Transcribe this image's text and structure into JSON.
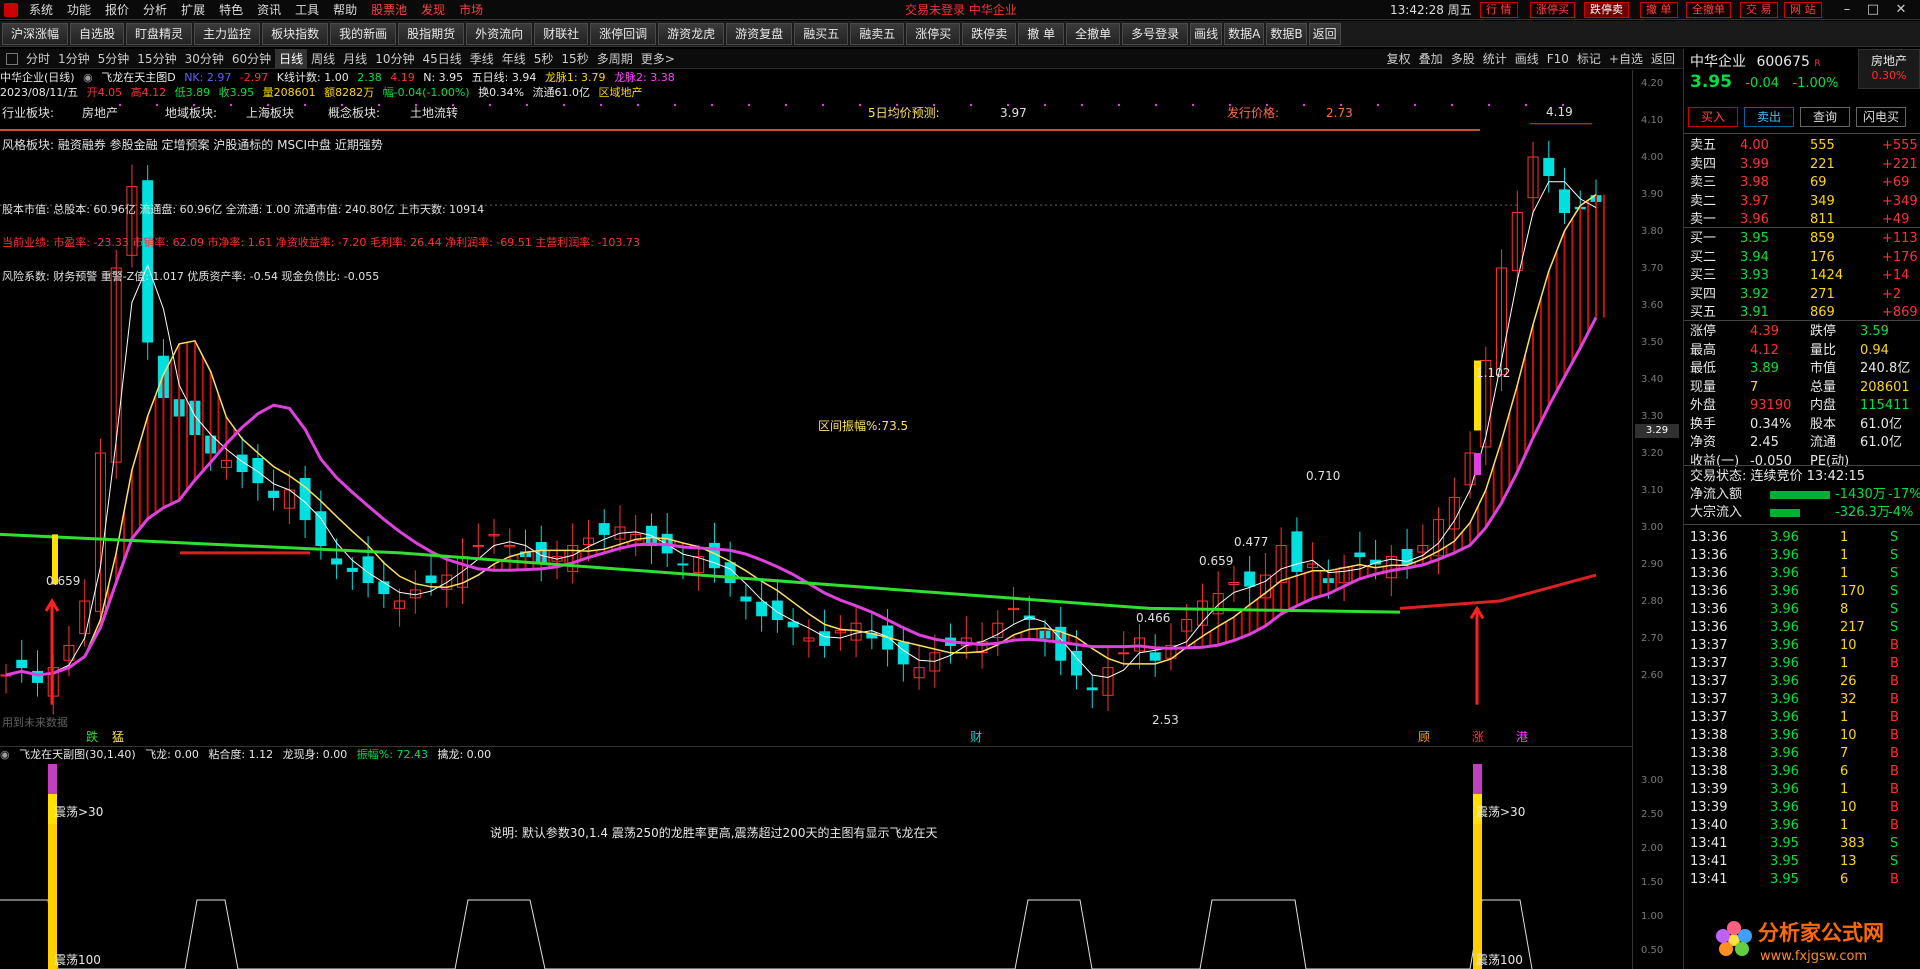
{
  "menu": {
    "items": [
      "系统",
      "功能",
      "报价",
      "分析",
      "扩展",
      "特色",
      "资讯",
      "工具",
      "帮助"
    ],
    "red_items": [
      "股票池",
      "发现",
      "市场"
    ],
    "center_text": "交易未登录  中华企业",
    "clock": "13:42:28 周五",
    "right_buttons": [
      "行 情",
      "涨停买",
      "跌停卖",
      "撤 单",
      "全撤单",
      "交 易",
      "网 站"
    ]
  },
  "toolbar": {
    "buttons": [
      "沪深涨幅",
      "自选股",
      "盯盘精灵",
      "主力监控",
      "板块指数",
      "我的新画",
      "股指期货",
      "外资流向",
      "财联社",
      "涨停回调",
      "游资龙虎",
      "游资复盘",
      "融买五",
      "融卖五",
      "涨停买",
      "跌停卖",
      "撤 单",
      "全撤单",
      "多号登录",
      "画线",
      "数据A",
      "数据B",
      "返回"
    ]
  },
  "periods": [
    "分时",
    "1分钟",
    "5分钟",
    "15分钟",
    "30分钟",
    "60分钟",
    "日线",
    "周线",
    "月线",
    "10分钟",
    "45日线",
    "季线",
    "年线",
    "5秒",
    "15秒",
    "多周期",
    "更多>"
  ],
  "period_active": "日线",
  "period_right": [
    "复权",
    "叠加",
    "多股",
    "统计",
    "画线",
    "F10",
    "标记",
    "+自选",
    "返回"
  ],
  "info1": {
    "name": "中华企业(日线)",
    "indicator": "飞龙在天主图D",
    "nk": "NK: 2.97",
    "v1": "-2.97",
    "kline": "K线计数: 1.00",
    "v2": "2.38",
    "v3": "4.19",
    "n": "N: 3.95",
    "ma5": "五日线: 3.94",
    "long1": "龙脉1: 3.79",
    "long2": "龙脉2: 3.38"
  },
  "info2": {
    "date": "2023/08/11/五",
    "open": "开4.05",
    "high": "高4.12",
    "low": "低3.89",
    "close": "收3.95",
    "vol": "量208601",
    "amt": "额8282万",
    "chg": "幅-0.04(-1.00%)",
    "turn": "换0.34%",
    "flow": "流通61.0亿",
    "sector": "区域地产"
  },
  "overlay": {
    "industry_label": "行业板块:",
    "industry": "房地产",
    "region_label": "地域板块:",
    "region": "上海板块",
    "concept_label": "概念板块:",
    "concept": "土地流转",
    "pred_label": "5日均价预测:",
    "pred": "3.97",
    "issue_label": "发行价格:",
    "issue": "2.73",
    "style": "风格板块:   融资融券 参股金融 定增预案 沪股通标的 MSCI中盘 近期强势",
    "capital": "股本市值: 总股本: 60.96亿 流通盘: 60.96亿 全流通: 1.00 流通市值: 240.80亿 上市天数: 10914",
    "perf": "当前业绩: 市盈率: -23.33 市销率: 62.09 市净率: 1.61 净资收益率: -7.20 毛利率: 26.44 净利润率: -69.51 主营利润率: -103.73",
    "risk": "风险系数: 财务预警 重警-Z值: 1.017 优质资产率: -0.54 现金负债比: -0.055",
    "range": "区间振幅%:73.5",
    "label_0710": "0.710",
    "label_0659a": "0.659",
    "label_0659b": "0.659",
    "label_0477": "0.477",
    "label_0466": "0.466",
    "label_1102": "1.102",
    "label_253": "2.53",
    "label_419": "4.19",
    "nofuture": "用到未来数据",
    "sig1": "跌",
    "sig2": "猛",
    "sig3": "财",
    "sig4": "顾",
    "sig5": "涨",
    "sig6": "港"
  },
  "sub": {
    "title": "飞龙在天副图(30,1.40)",
    "fly": "飞龙: 0.00",
    "fit": "粘合度: 1.12",
    "dragon": "龙现身: 0.00",
    "amp": "振幅%: 72.43",
    "catch": "擒龙: 0.00",
    "note": "说明: 默认参数30,1.4 震荡250的龙胜率更高,震荡超过200天的主图有显示飞龙在天",
    "z30": "震荡>30",
    "z100": "震荡100"
  },
  "axis": {
    "main": [
      "4.20",
      "4.10",
      "4.00",
      "3.90",
      "3.80",
      "3.70",
      "3.60",
      "3.50",
      "3.40",
      "3.30",
      "3.20",
      "3.10",
      "3.00",
      "2.90",
      "2.80",
      "2.70",
      "2.60"
    ],
    "current": "3.29",
    "sub": [
      "3.00",
      "2.50",
      "2.00",
      "1.50",
      "1.00",
      "0.50"
    ]
  },
  "stock": {
    "name": "中华企业",
    "code": "600675",
    "tag": "R",
    "sector": "房地产",
    "price": "3.95",
    "chg": "-0.04",
    "pct": "-1.00%",
    "sector_pct": "0.30%",
    "buttons": [
      "买入",
      "卖出",
      "查询",
      "闪电买"
    ]
  },
  "asks": [
    {
      "label": "卖五",
      "price": "4.00",
      "vol": "555",
      "chg": "+555"
    },
    {
      "label": "卖四",
      "price": "3.99",
      "vol": "221",
      "chg": "+221"
    },
    {
      "label": "卖三",
      "price": "3.98",
      "vol": "69",
      "chg": "+69"
    },
    {
      "label": "卖二",
      "price": "3.97",
      "vol": "349",
      "chg": "+349"
    },
    {
      "label": "卖一",
      "price": "3.96",
      "vol": "811",
      "chg": "+49"
    }
  ],
  "bids": [
    {
      "label": "买一",
      "price": "3.95",
      "vol": "859",
      "chg": "+113"
    },
    {
      "label": "买二",
      "price": "3.94",
      "vol": "176",
      "chg": "+176"
    },
    {
      "label": "买三",
      "price": "3.93",
      "vol": "1424",
      "chg": "+14"
    },
    {
      "label": "买四",
      "price": "3.92",
      "vol": "271",
      "chg": "+2"
    },
    {
      "label": "买五",
      "price": "3.91",
      "vol": "869",
      "chg": "+869"
    }
  ],
  "stats": [
    {
      "l": "涨停",
      "v": "4.39",
      "l2": "跌停",
      "v2": "3.59"
    },
    {
      "l": "最高",
      "v": "4.12",
      "l2": "量比",
      "v2": "0.94"
    },
    {
      "l": "最低",
      "v": "3.89",
      "l2": "市值",
      "v2": "240.8亿"
    },
    {
      "l": "现量",
      "v": "7",
      "l2": "总量",
      "v2": "208601"
    },
    {
      "l": "外盘",
      "v": "93190",
      "l2": "内盘",
      "v2": "115411"
    },
    {
      "l": "换手",
      "v": "0.34%",
      "l2": "股本",
      "v2": "61.0亿"
    },
    {
      "l": "净资",
      "v": "2.45",
      "l2": "流通",
      "v2": "61.0亿"
    },
    {
      "l": "收益(一)",
      "v": "-0.050",
      "l2": "PE(动)",
      "v2": ""
    }
  ],
  "trade_state": "交易状态: 连续竞价 13:42:15",
  "netflow": {
    "label": "净流入额",
    "value": "-1430万",
    "pct": "-17%"
  },
  "bigflow": {
    "label": "大宗流入",
    "value": "-326.3万",
    "pct": "-4%"
  },
  "ticks": [
    {
      "t": "13:36",
      "p": "3.96",
      "v": "1",
      "d": "S"
    },
    {
      "t": "13:36",
      "p": "3.96",
      "v": "1",
      "d": "S"
    },
    {
      "t": "13:36",
      "p": "3.96",
      "v": "1",
      "d": "S"
    },
    {
      "t": "13:36",
      "p": "3.96",
      "v": "170",
      "d": "S"
    },
    {
      "t": "13:36",
      "p": "3.96",
      "v": "8",
      "d": "S"
    },
    {
      "t": "13:36",
      "p": "3.96",
      "v": "217",
      "d": "S"
    },
    {
      "t": "13:37",
      "p": "3.96",
      "v": "10",
      "d": "B"
    },
    {
      "t": "13:37",
      "p": "3.96",
      "v": "1",
      "d": "B"
    },
    {
      "t": "13:37",
      "p": "3.96",
      "v": "26",
      "d": "B"
    },
    {
      "t": "13:37",
      "p": "3.96",
      "v": "32",
      "d": "B"
    },
    {
      "t": "13:37",
      "p": "3.96",
      "v": "1",
      "d": "B"
    },
    {
      "t": "13:38",
      "p": "3.96",
      "v": "10",
      "d": "B"
    },
    {
      "t": "13:38",
      "p": "3.96",
      "v": "7",
      "d": "B"
    },
    {
      "t": "13:38",
      "p": "3.96",
      "v": "6",
      "d": "B"
    },
    {
      "t": "13:39",
      "p": "3.96",
      "v": "1",
      "d": "B"
    },
    {
      "t": "13:39",
      "p": "3.96",
      "v": "10",
      "d": "B"
    },
    {
      "t": "13:40",
      "p": "3.96",
      "v": "1",
      "d": "B"
    },
    {
      "t": "13:41",
      "p": "3.95",
      "v": "383",
      "d": "S"
    },
    {
      "t": "13:41",
      "p": "3.95",
      "v": "13",
      "d": "S"
    },
    {
      "t": "13:41",
      "p": "3.95",
      "v": "6",
      "d": "B"
    }
  ],
  "watermark": {
    "title": "分析家公式网",
    "url": "www.fxjgsw.com"
  },
  "colors": {
    "up": "#ff3030",
    "down": "#00e0e0",
    "ma_white": "#ffffff",
    "ma_yellow": "#ffe060",
    "ma_magenta": "#e040e0",
    "ma_green": "#30e030",
    "ma_red": "#e02020"
  }
}
